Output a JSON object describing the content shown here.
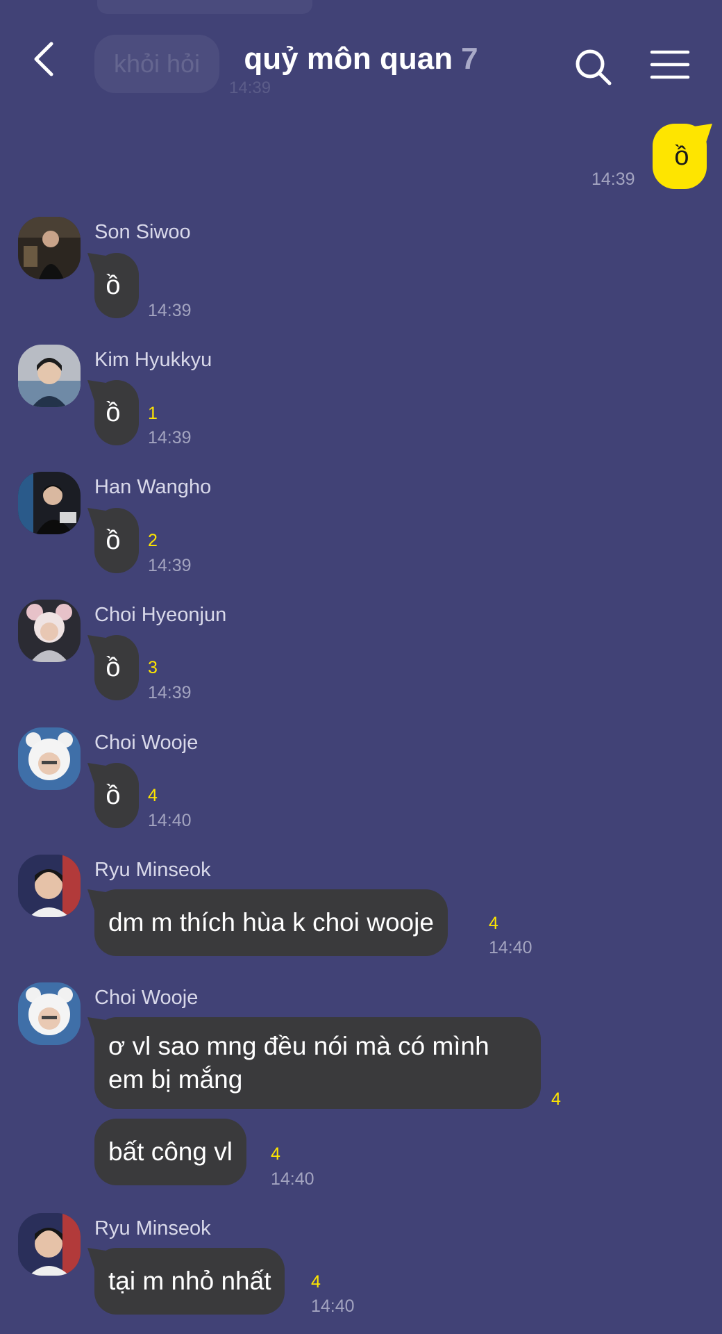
{
  "header": {
    "title": "quỷ môn quan",
    "member_count": "7",
    "back_icon": "chevron-left-icon",
    "search_icon": "search-icon",
    "menu_icon": "hamburger-menu-icon"
  },
  "ghost": {
    "text": "khỏi hỏi",
    "time": "14:39"
  },
  "colors": {
    "background": "#414276",
    "incoming_bubble": "#3a3a3c",
    "outgoing_bubble": "#fee500",
    "unread": "#fee500"
  },
  "my_message": {
    "text": "ồ",
    "time": "14:39"
  },
  "messages": [
    {
      "sender": "Son Siwoo",
      "bubbles": [
        {
          "text": "ồ",
          "unread": "",
          "time": "14:39"
        }
      ]
    },
    {
      "sender": "Kim Hyukkyu",
      "bubbles": [
        {
          "text": "ồ",
          "unread": "1",
          "time": "14:39"
        }
      ]
    },
    {
      "sender": "Han Wangho",
      "bubbles": [
        {
          "text": "ồ",
          "unread": "2",
          "time": "14:39"
        }
      ]
    },
    {
      "sender": "Choi Hyeonjun",
      "bubbles": [
        {
          "text": "ồ",
          "unread": "3",
          "time": "14:39"
        }
      ]
    },
    {
      "sender": "Choi Wooje",
      "bubbles": [
        {
          "text": "ồ",
          "unread": "4",
          "time": "14:40"
        }
      ]
    },
    {
      "sender": "Ryu Minseok",
      "bubbles": [
        {
          "text": "dm m thích hùa k choi wooje",
          "unread": "4",
          "time": "14:40"
        }
      ]
    },
    {
      "sender": "Choi Wooje",
      "bubbles": [
        {
          "line1": "ơ vl sao mng đều nói mà có mình",
          "line2": "em bị mắng",
          "unread": "4"
        },
        {
          "text": "bất công vl",
          "unread": "4",
          "time": "14:40"
        }
      ]
    },
    {
      "sender": "Ryu Minseok",
      "bubbles": [
        {
          "text": "tại m nhỏ nhất",
          "unread": "4",
          "time": "14:40"
        }
      ]
    }
  ]
}
